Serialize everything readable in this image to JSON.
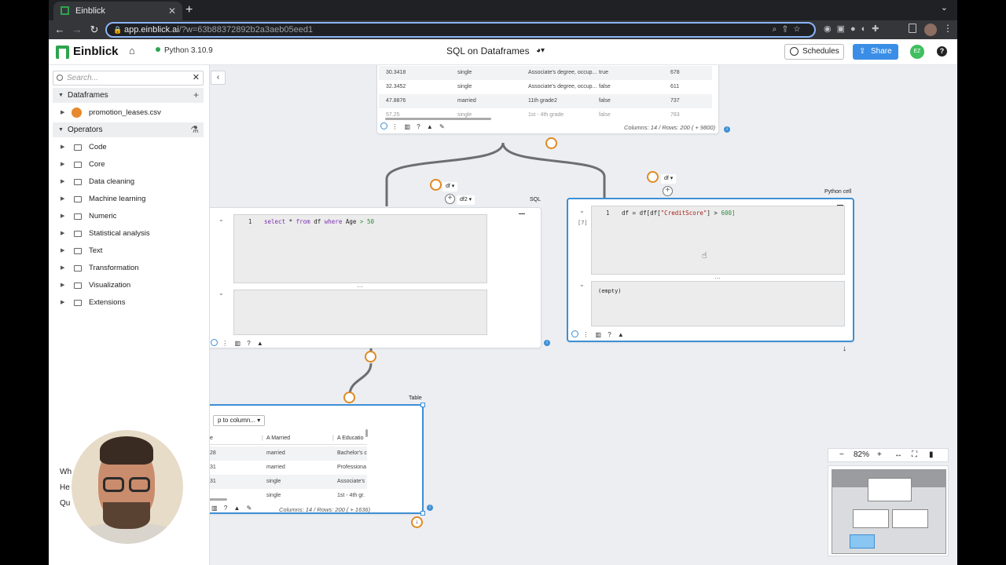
{
  "browser": {
    "tab_title": "Einblick",
    "url_host": "app.einblick.ai",
    "url_path": "/?w=63b88372892b2a3aeb05eed1"
  },
  "app": {
    "brand": "Einblick",
    "runtime": "Python 3.10.9",
    "notebook_title": "SQL on Dataframes",
    "schedules_label": "Schedules",
    "share_label": "Share",
    "avatar_initials": "EZ",
    "help": "?"
  },
  "sidebar": {
    "search_placeholder": "Search...",
    "dataframes_label": "Dataframes",
    "dataframe_file": "promotion_leases.csv",
    "operators_label": "Operators",
    "operators": [
      "Code",
      "Core",
      "Data cleaning",
      "Machine learning",
      "Numeric",
      "Statistical analysis",
      "Text",
      "Transformation",
      "Visualization",
      "Extensions"
    ],
    "behind_cam": [
      "Wh",
      "He",
      "Qu"
    ]
  },
  "canvas": {
    "top_table": {
      "rows": [
        [
          "30.3418",
          "single",
          "Associate's degree, occup...",
          "true",
          "678"
        ],
        [
          "32.3452",
          "single",
          "Associate's degree, occup...",
          "false",
          "611"
        ],
        [
          "47.8876",
          "married",
          "11th grade2",
          "false",
          "737"
        ],
        [
          "57.25",
          "single",
          "1st - 4th grade",
          "false",
          "783"
        ]
      ],
      "footer_info": "Columns: 14 / Rows: 200 ( + 9800)"
    },
    "sql_cell": {
      "label": "SQL",
      "input_pill": "df2",
      "edge_pill": "df",
      "line_no": "1",
      "code_select": "select",
      "code_star": "*",
      "code_from": "from",
      "code_df": "df",
      "code_where": "where",
      "code_col": "Age",
      "code_op": ">",
      "code_num": "50"
    },
    "python_cell": {
      "label": "Python cell",
      "edge_pill": "df",
      "exec_count": "[7]",
      "line_no": "1",
      "code_pre": "df = df[df[",
      "code_str": "\"CreditScore\"",
      "code_post": "] >",
      "code_num": "600]",
      "output": "(empty)"
    },
    "table_cell": {
      "label": "Table",
      "jump_label": "p to column...",
      "col_married": "Married",
      "col_education": "Educatio",
      "rows": [
        [
          "28",
          "married",
          "Bachelor's c"
        ],
        [
          "31",
          "married",
          "Professiona"
        ],
        [
          "31",
          "single",
          "Associate's"
        ],
        [
          "",
          "single",
          "1st - 4th gr."
        ]
      ],
      "footer_info": "Columns: 14 / Rows: 200 ( + 1636)"
    },
    "zoom": "82%"
  },
  "colors": {
    "accent": "#3d8fd4",
    "port": "#e08a23",
    "brand": "#2ea44f"
  }
}
